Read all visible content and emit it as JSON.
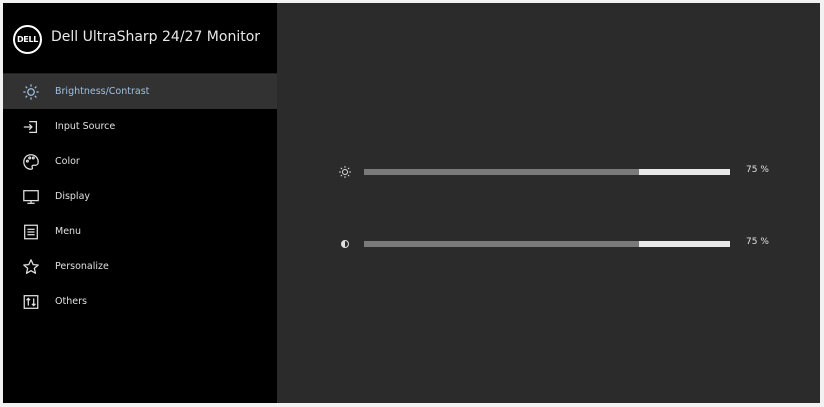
{
  "header": {
    "logo_text": "DELL",
    "model": "Dell UltraSharp 24/27 Monitor"
  },
  "menu": {
    "items": [
      {
        "label": "Brightness/Contrast",
        "icon": "brightness-icon",
        "active": true
      },
      {
        "label": "Input Source",
        "icon": "input-source-icon",
        "active": false
      },
      {
        "label": "Color",
        "icon": "palette-icon",
        "active": false
      },
      {
        "label": "Display",
        "icon": "display-icon",
        "active": false
      },
      {
        "label": "Menu",
        "icon": "menu-icon",
        "active": false
      },
      {
        "label": "Personalize",
        "icon": "star-icon",
        "active": false
      },
      {
        "label": "Others",
        "icon": "others-icon",
        "active": false
      }
    ]
  },
  "sliders": {
    "brightness": {
      "value": 75,
      "display": "75 %",
      "icon": "brightness-icon"
    },
    "contrast": {
      "value": 75,
      "display": "75 %",
      "icon": "contrast-icon"
    }
  },
  "colors": {
    "sidebar_bg": "#000000",
    "content_bg": "#2b2b2b",
    "active_item_bg": "#323232",
    "active_label": "#9fc0e0",
    "slider_track": "#e8e8e8",
    "slider_fill": "#7a7a7a"
  }
}
